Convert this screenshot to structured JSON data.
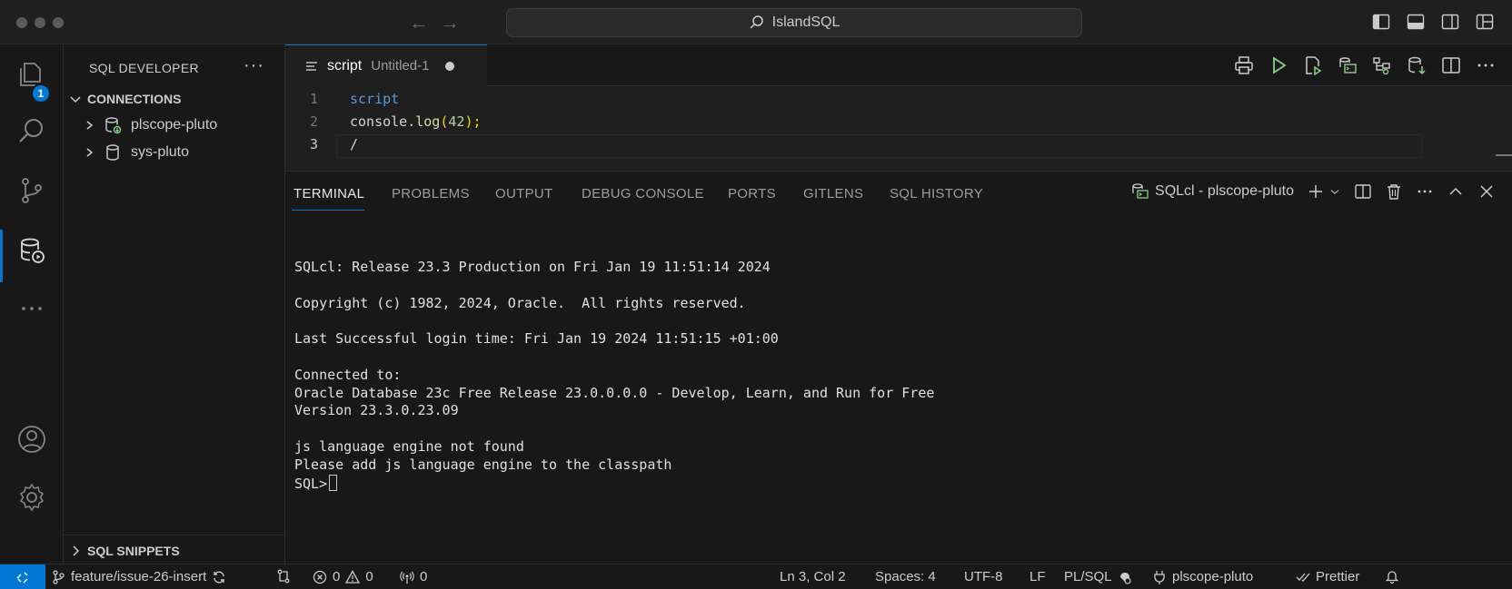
{
  "window": {
    "title": "IslandSQL"
  },
  "sidebar": {
    "title": "SQL DEVELOPER",
    "more_label": "···",
    "connections_label": "CONNECTIONS",
    "connections": [
      {
        "label": "plscope-pluto"
      },
      {
        "label": "sys-pluto"
      }
    ],
    "snippets_label": "SQL SNIPPETS"
  },
  "activity": {
    "explorer_badge": "1"
  },
  "editor": {
    "tab": {
      "title": "script",
      "description": "Untitled-1"
    },
    "lines": [
      {
        "num": "1",
        "text": "script"
      },
      {
        "num": "2",
        "text_parts": [
          "console",
          ".",
          "log",
          "(",
          "42",
          ");"
        ]
      },
      {
        "num": "3",
        "text": "/"
      }
    ]
  },
  "panel": {
    "tabs": [
      "TERMINAL",
      "PROBLEMS",
      "OUTPUT",
      "DEBUG CONSOLE",
      "PORTS",
      "GITLENS",
      "SQL HISTORY"
    ],
    "terminal_name": "SQLcl - plscope-pluto",
    "terminal_lines": [
      "SQLcl: Release 23.3 Production on Fri Jan 19 11:51:14 2024",
      "",
      "Copyright (c) 1982, 2024, Oracle.  All rights reserved.",
      "",
      "Last Successful login time: Fri Jan 19 2024 11:51:15 +01:00",
      "",
      "Connected to:",
      "Oracle Database 23c Free Release 23.0.0.0.0 - Develop, Learn, and Run for Free",
      "Version 23.3.0.23.09",
      "",
      "js language engine not found",
      "Please add js language engine to the classpath"
    ],
    "prompt": "SQL>"
  },
  "statusbar": {
    "branch": "feature/issue-26-insert",
    "errors": "0",
    "warnings": "0",
    "ports": "0",
    "cursor": "Ln 3, Col 2",
    "spaces": "Spaces: 4",
    "encoding": "UTF-8",
    "eol": "LF",
    "language": "PL/SQL",
    "connection": "plscope-pluto",
    "prettier": "Prettier"
  },
  "colors": {
    "accent": "#0078d4",
    "keyword": "#569cd6",
    "function": "#dcdcaa",
    "number": "#b5cea8",
    "run_green": "#89d185"
  }
}
